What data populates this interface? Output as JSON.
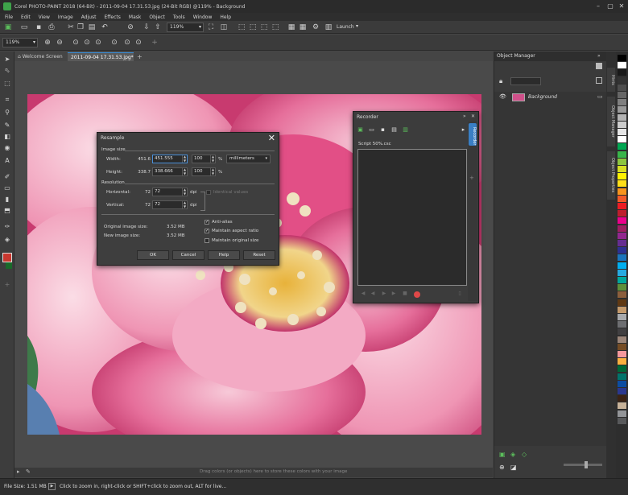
{
  "window": {
    "title": "Corel PHOTO-PAINT 2018 (64-Bit) - 2011-09-04 17.31.53.jpg (24-Bit RGB) @119% - Background"
  },
  "menu": [
    "File",
    "Edit",
    "View",
    "Image",
    "Adjust",
    "Effects",
    "Mask",
    "Object",
    "Tools",
    "Window",
    "Help"
  ],
  "toolbar": {
    "zoom_value": "119%",
    "launch_label": "Launch",
    "prop_zoom_value": "119%"
  },
  "tabs": {
    "welcome": "Welcome Screen",
    "document": "2011-09-04 17.31.53.jpg*",
    "add": "+"
  },
  "resample": {
    "title": "Resample",
    "image_size_label": "Image size",
    "width_label": "Width:",
    "height_label": "Height:",
    "width_orig": "451.6",
    "height_orig": "338.7",
    "width_value": "451.555",
    "height_value": "338.666",
    "width_pct": "100",
    "height_pct": "100",
    "pct_symbol": "%",
    "units": "millimeters",
    "resolution_label": "Resolution",
    "horizontal_label": "Horizontal:",
    "vertical_label": "Vertical:",
    "horizontal_orig": "72",
    "vertical_orig": "72",
    "horizontal_value": "72",
    "vertical_value": "72",
    "dpi": "dpi",
    "identical_values": "Identical values",
    "original_size_label": "Original image size:",
    "new_size_label": "New image size:",
    "original_size": "3.52 MB",
    "new_size": "3.52 MB",
    "antialias": "Anti-alias",
    "maintain_ratio": "Maintain aspect ratio",
    "maintain_size": "Maintain original size",
    "ok": "OK",
    "cancel": "Cancel",
    "help": "Help",
    "reset": "Reset"
  },
  "recorder": {
    "title": "Recorder",
    "script": "Script 50%.csc"
  },
  "object_manager": {
    "title": "Object Manager",
    "layer": "Background"
  },
  "dock_tabs": [
    "Hints",
    "Object Manager",
    "Object Properties"
  ],
  "recorder_side_tab": "Recorder",
  "palette": [
    "#000000",
    "#ffffff",
    "#1a1a1a",
    "#333333",
    "#4d4d4d",
    "#666666",
    "#808080",
    "#999999",
    "#b3b3b3",
    "#cccccc",
    "#e6e6e6",
    "#ffffff",
    "#00a651",
    "#39b54a",
    "#8dc63f",
    "#d7df23",
    "#fff200",
    "#ffde17",
    "#f7941d",
    "#f15a29",
    "#ed1c24",
    "#be1e2d",
    "#ec008c",
    "#9e1f63",
    "#92278f",
    "#662d91",
    "#2e3192",
    "#1b75bc",
    "#00aeef",
    "#27aae1",
    "#00a79d",
    "#5e8f3a",
    "#8b5e3c",
    "#603913",
    "#c49a6c",
    "#a7a9ac",
    "#6d6e71",
    "#414042",
    "#9b8579",
    "#754c24",
    "#f5989d",
    "#fbb040",
    "#006838",
    "#00746b",
    "#0c4da2",
    "#2b388f",
    "#3b2314",
    "#c7b299",
    "#939598",
    "#58595b"
  ],
  "hint": "Drag colors (or objects) here to store these colors with your image",
  "status": {
    "file_size": "File Size: 1.51 MB",
    "message": "Click to zoom in, right-click or SHIFT+click to zoom out, ALT for live..."
  }
}
